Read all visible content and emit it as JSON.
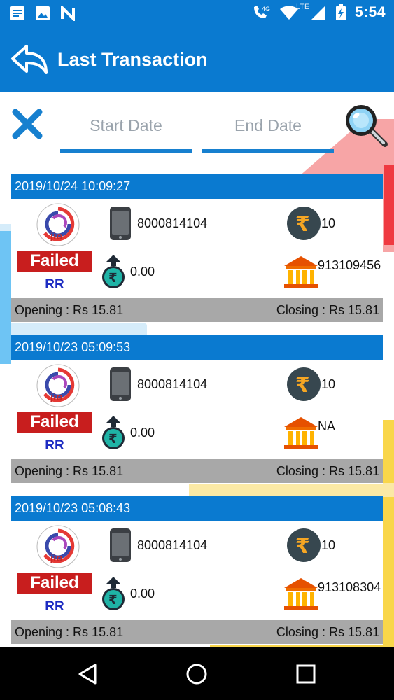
{
  "status_bar": {
    "time": "5:54",
    "network_4g": "4G",
    "network_lte": "LTE",
    "icons": [
      "notes-icon",
      "image-icon",
      "n-app-icon",
      "call-4g-icon",
      "wifi-icon",
      "lte-signal-icon",
      "battery-charging-icon"
    ]
  },
  "header": {
    "title": "Last Transaction",
    "back_icon": "back-arrow-icon"
  },
  "filters": {
    "start_date_placeholder": "Start Date",
    "end_date_placeholder": "End Date",
    "clear_icon": "close-icon",
    "search_icon": "search-icon"
  },
  "colors": {
    "primary": "#0a7ad0",
    "failed": "#c81e1e",
    "rr": "#1d2cc2",
    "footer_gray": "#a8a8a8"
  },
  "transactions": [
    {
      "datetime": "2019/10/24 10:09:27",
      "operator": "jio",
      "status": "Failed",
      "type": "RR",
      "mobile": "8000814104",
      "amount": "10",
      "balance": "0.00",
      "operator_id": "913109456",
      "opening": "Opening : Rs 15.81",
      "closing": "Closing : Rs 15.81"
    },
    {
      "datetime": "2019/10/23 05:09:53",
      "operator": "jio",
      "status": "Failed",
      "type": "RR",
      "mobile": "8000814104",
      "amount": "10",
      "balance": "0.00",
      "operator_id": "NA",
      "opening": "Opening : Rs 15.81",
      "closing": "Closing : Rs 15.81"
    },
    {
      "datetime": "2019/10/23 05:08:43",
      "operator": "jio",
      "status": "Failed",
      "type": "RR",
      "mobile": "8000814104",
      "amount": "10",
      "balance": "0.00",
      "operator_id": "913108304",
      "opening": "Opening : Rs 15.81",
      "closing": "Closing : Rs 15.81"
    }
  ],
  "nav_bar": {
    "icons": [
      "back-triangle-icon",
      "home-circle-icon",
      "recents-square-icon"
    ]
  }
}
